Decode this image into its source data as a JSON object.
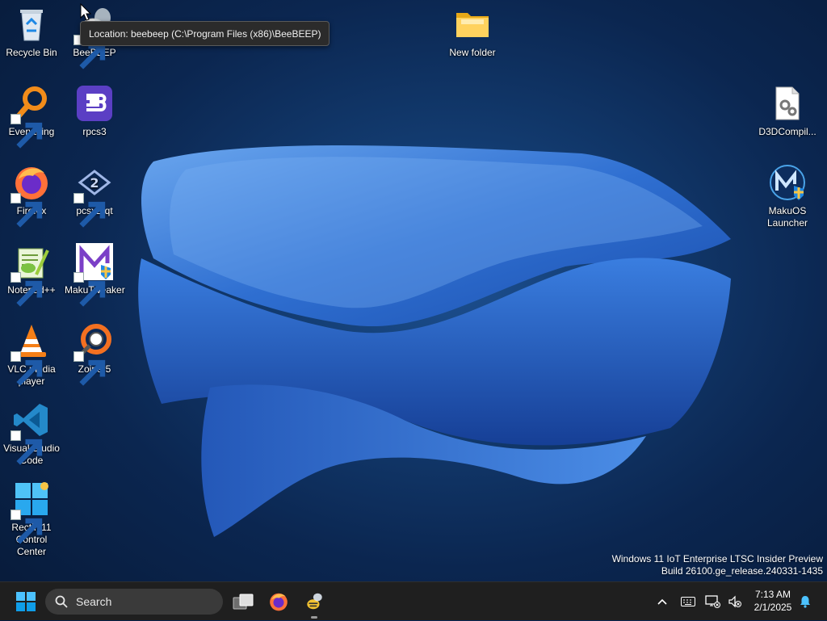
{
  "desktop": {
    "icons": [
      {
        "label": "Recycle Bin",
        "icon": "recycle-bin-icon"
      },
      {
        "label": "BeeBEEP",
        "icon": "beebeep-icon"
      },
      {
        "label": "Everything",
        "icon": "everything-search-icon"
      },
      {
        "label": "rpcs3",
        "icon": "rpcs3-icon"
      },
      {
        "label": "Firefox",
        "icon": "firefox-icon"
      },
      {
        "label": "pcsx2-qt",
        "icon": "pcsx2-icon"
      },
      {
        "label": "Notepad++",
        "icon": "notepad-plus-plus-icon"
      },
      {
        "label": "MakuTweaker",
        "icon": "makutweaker-icon"
      },
      {
        "label": "VLC media player",
        "icon": "vlc-icon"
      },
      {
        "label": "Zoiper5",
        "icon": "zoiper-icon"
      },
      {
        "label": "Visual Studio Code",
        "icon": "vscode-icon"
      },
      {
        "label": "Rectify11 Control Center",
        "icon": "rectify11-icon"
      },
      {
        "label": "New folder",
        "icon": "folder-icon"
      },
      {
        "label": "D3DCompil...",
        "icon": "settings-file-icon"
      },
      {
        "label": "MakuOS Launcher",
        "icon": "makuos-launcher-icon"
      }
    ]
  },
  "tooltip": {
    "text": "Location: beebeep (C:\\Program Files (x86)\\BeeBEEP)"
  },
  "watermark": {
    "line1": "Windows 11 IoT Enterprise LTSC Insider Preview",
    "line2": "Build 26100.ge_release.240331-1435"
  },
  "taskbar": {
    "start_icon": "windows-start-icon",
    "search_label": "Search",
    "pinned": [
      {
        "name": "task-view-icon"
      },
      {
        "name": "firefox-icon"
      },
      {
        "name": "beebeep-icon",
        "running": true
      }
    ],
    "tray": {
      "time": "7:13 AM",
      "date": "2/1/2025"
    }
  },
  "colors": {
    "accent": "#0078d4",
    "taskbar": "#1f1f1f",
    "wallpaper_blue": "#2f6fd1"
  }
}
